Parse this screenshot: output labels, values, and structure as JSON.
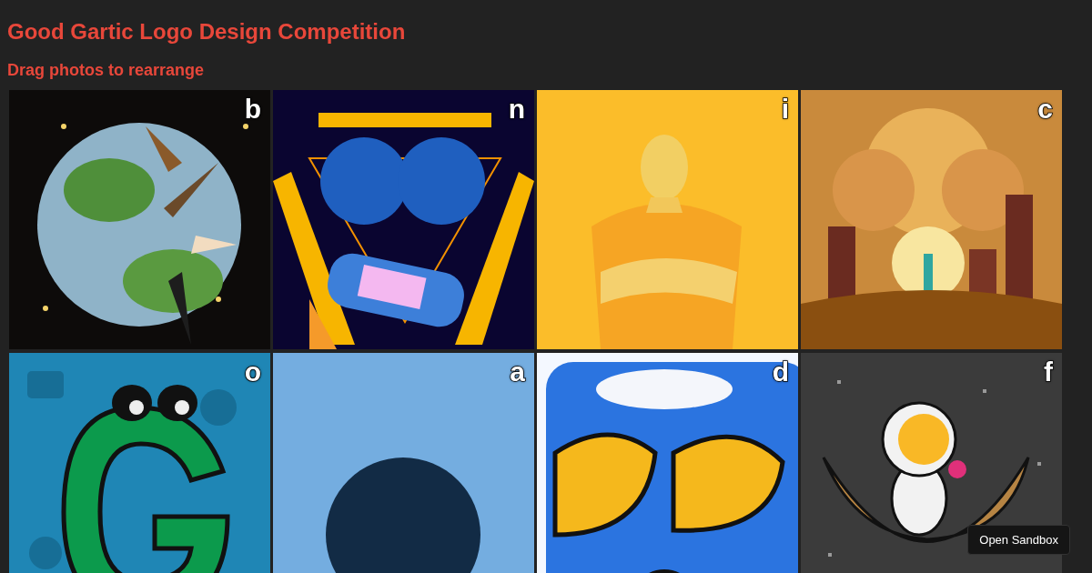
{
  "title": "Good Gartic Logo Design Competition",
  "subtitle": "Drag photos to rearrange",
  "photos": [
    {
      "label": "b",
      "kind": "picture"
    },
    {
      "label": "n",
      "kind": "picture"
    },
    {
      "label": "i",
      "kind": "picture"
    },
    {
      "label": "c",
      "kind": "picture"
    },
    {
      "label": "o",
      "kind": "picture"
    },
    {
      "label": "a",
      "kind": "picture"
    },
    {
      "label": "d",
      "kind": "picture"
    },
    {
      "label": "f",
      "kind": "picture"
    }
  ],
  "sandbox_button": "Open Sandbox"
}
